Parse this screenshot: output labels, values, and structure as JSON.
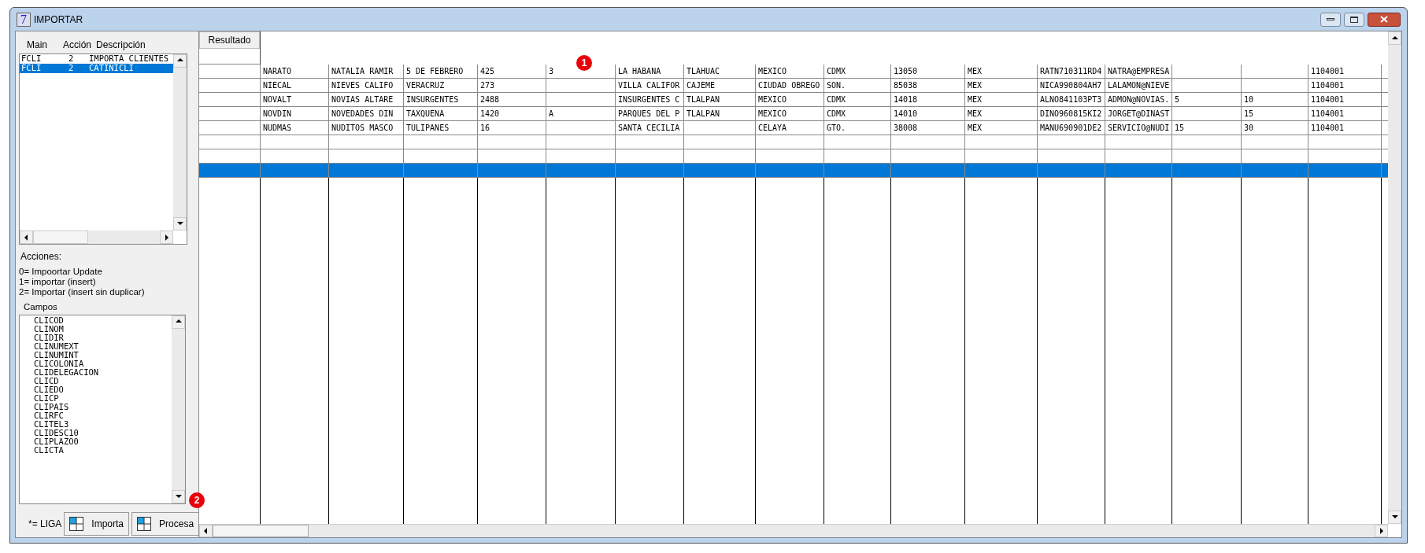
{
  "window": {
    "icon_label": "7",
    "title": "IMPORTAR"
  },
  "main_list": {
    "columns": [
      "Main",
      "Acción",
      "Descripción"
    ],
    "rows": [
      {
        "main": "FCLI",
        "accion": "2",
        "descripcion": "IMPORTA CLIENTES",
        "selected": false
      },
      {
        "main": "FCLI",
        "accion": "2",
        "descripcion": "CATINICLI",
        "selected": true
      }
    ]
  },
  "acciones": {
    "label": "Acciones:",
    "lines": [
      "0= Impoortar Update",
      "1= importar (insert)",
      "2= Importar (insert sin duplicar)"
    ]
  },
  "campos": {
    "label": "Campos",
    "items": [
      "CLICOD",
      "CLINOM",
      "CLIDIR",
      "CLINUMEXT",
      "CLINUMINT",
      "CLICOLONIA",
      "CLIDELEGACION",
      "CLICD",
      "CLIEDO",
      "CLICP",
      "CLIPAIS",
      "CLIRFC",
      "CLITEL3",
      "CLIDESC10",
      "CLIPLAZO0",
      "CLICTA"
    ]
  },
  "footer": {
    "legend": "*= LIGA",
    "buttons": [
      "Importa",
      "Procesa"
    ]
  },
  "grid": {
    "header_button": "Resultado",
    "rows": [
      {
        "selected": false,
        "cells": [
          "NARATO",
          "NATALIA RAMIR",
          "5 DE FEBRERO",
          "425",
          "3",
          "LA HABANA",
          "TLAHUAC",
          "MEXICO",
          "CDMX",
          "13050",
          "MEX",
          "RATN710311RD4",
          "NATRA@EMPRESA",
          null,
          null,
          "1104001"
        ]
      },
      {
        "selected": false,
        "cells": [
          "NIECAL",
          "NIEVES CALIFO",
          "VERACRUZ",
          "273",
          null,
          "VILLA CALIFOR",
          "CAJEME",
          "CIUDAD OBREGO",
          "SON.",
          "85038",
          "MEX",
          "NICA990804AH7",
          "LALAMON@NIEVE",
          null,
          null,
          "1104001"
        ]
      },
      {
        "selected": false,
        "cells": [
          "NOVALT",
          "NOVIAS ALTARE",
          "INSURGENTES",
          "2488",
          null,
          "INSURGENTES C",
          "TLALPAN",
          "MEXICO",
          "CDMX",
          "14018",
          "MEX",
          "ALNO841103PT3",
          "ADMON@NOVIAS.",
          "5",
          "10",
          "1104001"
        ]
      },
      {
        "selected": false,
        "cells": [
          "NOVDIN",
          "NOVEDADES DIN",
          "TAXQUENA",
          "1420",
          "A",
          "PARQUES DEL P",
          "TLALPAN",
          "MEXICO",
          "CDMX",
          "14010",
          "MEX",
          "DINO960815KI2",
          "JORGET@DINAST",
          null,
          "15",
          "1104001"
        ]
      },
      {
        "selected": false,
        "cells": [
          "NUDMAS",
          "NUDITOS MASCO",
          "TULIPANES",
          "16",
          null,
          "SANTA CECILIA",
          null,
          "CELAYA",
          "GTO.",
          "38008",
          "MEX",
          "MANU690901DE2",
          "SERVICIO@NUDI",
          "15",
          "30",
          "1104001"
        ]
      },
      {
        "selected": false,
        "cells": []
      },
      {
        "selected": false,
        "cells": []
      },
      {
        "selected": true,
        "cells": []
      }
    ]
  },
  "annotation_markers": [
    {
      "label": "1"
    },
    {
      "label": "2"
    }
  ]
}
